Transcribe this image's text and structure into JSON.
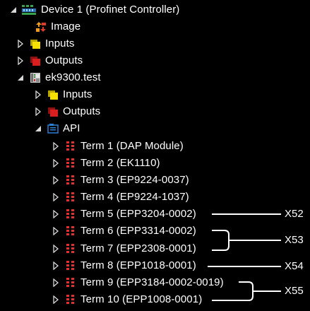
{
  "tree": {
    "root": {
      "label": "Device 1 (Profinet Controller)",
      "icon": "device-controller-icon"
    },
    "items": [
      {
        "label": "Image",
        "icon": "image-icon"
      },
      {
        "label": "Inputs",
        "icon": "inputs-icon"
      },
      {
        "label": "Outputs",
        "icon": "outputs-icon"
      },
      {
        "label": "ek9300.test",
        "icon": "box-device-icon"
      },
      {
        "label": "Inputs",
        "icon": "inputs-icon"
      },
      {
        "label": "Outputs",
        "icon": "outputs-icon"
      },
      {
        "label": "API",
        "icon": "api-icon"
      },
      {
        "label": "Term 1 (DAP Module)",
        "icon": "terminal-module-icon"
      },
      {
        "label": "Term 2 (EK1110)",
        "icon": "terminal-module-icon"
      },
      {
        "label": "Term 3 (EP9224-0037)",
        "icon": "terminal-module-icon"
      },
      {
        "label": "Term 4 (EP9224-1037)",
        "icon": "terminal-module-icon"
      },
      {
        "label": "Term 5 (EPP3204-0002)",
        "icon": "terminal-module-icon"
      },
      {
        "label": "Term 6 (EPP3314-0002)",
        "icon": "terminal-module-icon"
      },
      {
        "label": "Term 7 (EPP2308-0001)",
        "icon": "terminal-module-icon"
      },
      {
        "label": "Term 8 (EPP1018-0001)",
        "icon": "terminal-module-icon"
      },
      {
        "label": "Term 9 (EPP3184-0002-0019)",
        "icon": "terminal-module-icon"
      },
      {
        "label": "Term 10 (EPP1008-0001)",
        "icon": "terminal-module-icon"
      }
    ]
  },
  "annotations": {
    "x52": "X52",
    "x53": "X53",
    "x54": "X54",
    "x55": "X55"
  },
  "colors": {
    "background": "#000000",
    "text": "#ffffff",
    "expander": "#d8d8d8",
    "terminal_red": "#e03030",
    "inputs_yellow": "#f5e000",
    "outputs_red": "#d81e1e",
    "api_blue": "#2a7fd4"
  }
}
